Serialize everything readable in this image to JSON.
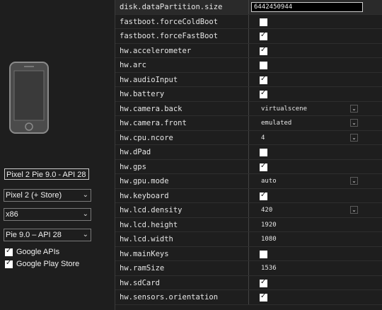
{
  "left": {
    "avd_name": "Pixel 2 Pie 9.0 - API 28",
    "device": "Pixel 2 (+ Store)",
    "abi": "x86",
    "target": "Pie 9.0 – API 28",
    "google_apis_label": "Google APIs",
    "google_apis_checked": true,
    "play_store_label": "Google Play Store",
    "play_store_checked": true,
    "chevron_glyph": "⌄"
  },
  "properties": [
    {
      "key": "disk.dataPartition.size",
      "type": "text",
      "value": "6442450944"
    },
    {
      "key": "fastboot.forceColdBoot",
      "type": "checkbox",
      "checked": false
    },
    {
      "key": "fastboot.forceFastBoot",
      "type": "checkbox",
      "checked": true
    },
    {
      "key": "hw.accelerometer",
      "type": "checkbox",
      "checked": true
    },
    {
      "key": "hw.arc",
      "type": "checkbox",
      "checked": false
    },
    {
      "key": "hw.audioInput",
      "type": "checkbox",
      "checked": true
    },
    {
      "key": "hw.battery",
      "type": "checkbox",
      "checked": true
    },
    {
      "key": "hw.camera.back",
      "type": "dropdown",
      "value": "virtualscene"
    },
    {
      "key": "hw.camera.front",
      "type": "dropdown",
      "value": "emulated"
    },
    {
      "key": "hw.cpu.ncore",
      "type": "dropdown",
      "value": "4"
    },
    {
      "key": "hw.dPad",
      "type": "checkbox",
      "checked": false
    },
    {
      "key": "hw.gps",
      "type": "checkbox",
      "checked": true
    },
    {
      "key": "hw.gpu.mode",
      "type": "dropdown",
      "value": "auto"
    },
    {
      "key": "hw.keyboard",
      "type": "checkbox",
      "checked": true
    },
    {
      "key": "hw.lcd.density",
      "type": "dropdown",
      "value": "420"
    },
    {
      "key": "hw.lcd.height",
      "type": "static",
      "value": "1920"
    },
    {
      "key": "hw.lcd.width",
      "type": "static",
      "value": "1080"
    },
    {
      "key": "hw.mainKeys",
      "type": "checkbox",
      "checked": false
    },
    {
      "key": "hw.ramSize",
      "type": "static",
      "value": "1536"
    },
    {
      "key": "hw.sdCard",
      "type": "checkbox",
      "checked": true
    },
    {
      "key": "hw.sensors.orientation",
      "type": "checkbox",
      "checked": true
    }
  ],
  "colors": {
    "background": "#1e1e1e",
    "text": "#e6e6e6",
    "checkbox": "#ffffff"
  },
  "icons": {
    "phone": "smartphone-icon",
    "dropdown": "chevron-down-icon",
    "check": "checkmark-icon"
  }
}
